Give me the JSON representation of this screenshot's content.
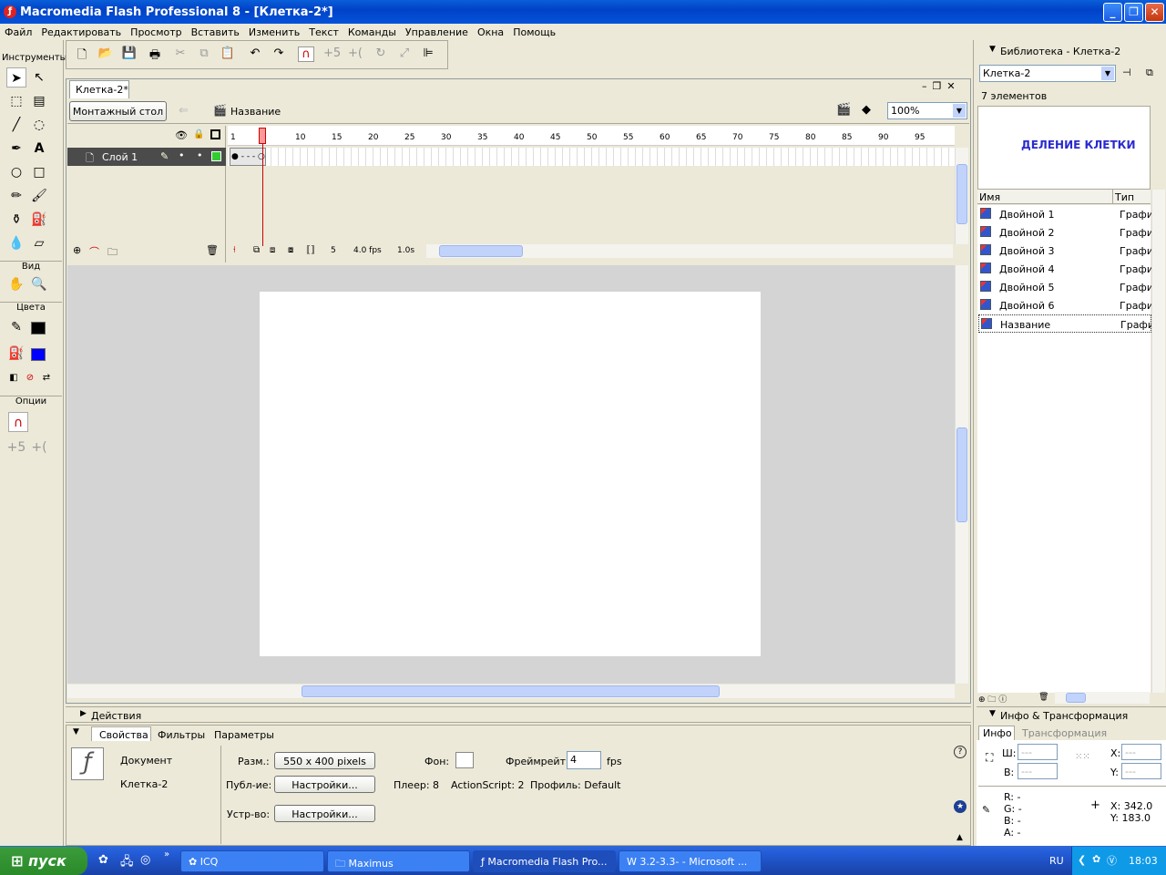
{
  "window": {
    "title": "Macromedia Flash Professional 8 - [Клетка-2*]",
    "app_icon": "flash-icon"
  },
  "menu": [
    "Файл",
    "Редактировать",
    "Просмотр",
    "Вставить",
    "Изменить",
    "Текст",
    "Команды",
    "Управление",
    "Окна",
    "Помощь"
  ],
  "tools": {
    "header": "Инструменты",
    "view_header": "Вид",
    "colors_header": "Цвета",
    "options_header": "Опции"
  },
  "document": {
    "tab_label": "Клетка-2*",
    "scene_button": "Монтажный стол",
    "symbol_label": "Название",
    "zoom": "100%"
  },
  "timeline": {
    "layer_name": "Слой 1",
    "ruler": [
      "1",
      "5",
      "10",
      "15",
      "20",
      "25",
      "30",
      "35",
      "40",
      "45",
      "50",
      "55",
      "60",
      "65",
      "70",
      "75",
      "80",
      "85",
      "90",
      "95"
    ],
    "current_frame": "5",
    "fps": "4.0 fps",
    "time": "1.0s"
  },
  "panels": {
    "actions_title": "Действия",
    "properties_tabs": [
      "Свойства",
      "Фильтры",
      "Параметры"
    ]
  },
  "properties": {
    "doc_type": "Документ",
    "doc_name": "Клетка-2",
    "size_label": "Разм.:",
    "size_value": "550 x 400 pixels",
    "bg_label": "Фон:",
    "framerate_label": "Фреймрейт:",
    "framerate_value": "4",
    "fps_unit": "fps",
    "publish_label": "Публ-ие:",
    "settings_button": "Настройки...",
    "player_label": "Плеер: 8",
    "actionscript_label": "ActionScript:  2",
    "profile_label": "Профиль: Default",
    "device_label": "Устр-во:",
    "device_button": "Настройки..."
  },
  "library": {
    "title": "Библиотека - Клетка-2",
    "selected": "Клетка-2",
    "count": "7 элементов",
    "preview_text": "ДЕЛЕНИЕ КЛЕТКИ",
    "col_name": "Имя",
    "col_type": "Тип",
    "items": [
      {
        "name": "Двойной 1",
        "type": "Графи"
      },
      {
        "name": "Двойной 2",
        "type": "Графи"
      },
      {
        "name": "Двойной 3",
        "type": "Графи"
      },
      {
        "name": "Двойной 4",
        "type": "Графи"
      },
      {
        "name": "Двойной 5",
        "type": "Графи"
      },
      {
        "name": "Двойной 6",
        "type": "Графи"
      },
      {
        "name": "Название",
        "type": "Графи"
      }
    ]
  },
  "info": {
    "title": "Инфо & Трансформация",
    "tab_info": "Инфо",
    "tab_transform": "Трансформация",
    "w_label": "Ш:",
    "h_label": "В:",
    "x_label": "X:",
    "y_label": "Y:",
    "empty": "---",
    "r": "R: -",
    "g": "G: -",
    "b": "B: -",
    "a": "A: -",
    "cursor_x": "X:  342.0",
    "cursor_y": "Y:  183.0"
  },
  "taskbar": {
    "start": "пуск",
    "items": [
      "ICQ",
      "Maximus",
      "Macromedia Flash Pro...",
      "3.2-3.3- - Microsoft ..."
    ],
    "lang": "RU",
    "clock": "18:03"
  },
  "colors": {
    "stroke": "#000000",
    "fill": "#0000ff",
    "accent": "#2a2ad0"
  }
}
